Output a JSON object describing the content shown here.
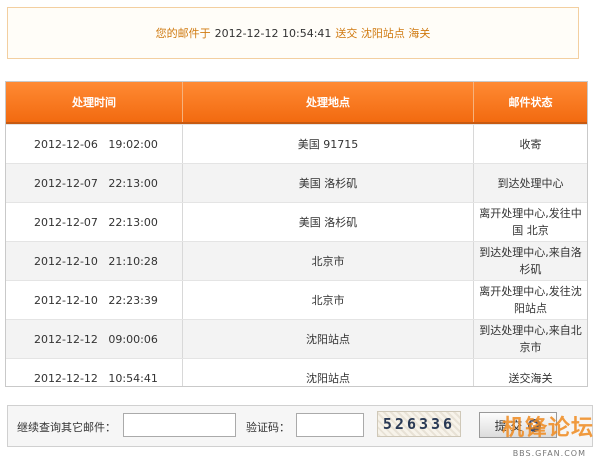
{
  "notice": {
    "prefix": "您的邮件于",
    "datetime": "2012-12-12 10:54:41",
    "status": "送交 沈阳站点 海关"
  },
  "table": {
    "headers": [
      "处理时间",
      "处理地点",
      "邮件状态"
    ],
    "rows": [
      {
        "time": "2012-12-06   19:02:00",
        "location": "美国 91715",
        "status": "收寄"
      },
      {
        "time": "2012-12-07   22:13:00",
        "location": "美国 洛杉矶",
        "status": "到达处理中心"
      },
      {
        "time": "2012-12-07   22:13:00",
        "location": "美国 洛杉矶",
        "status": "离开处理中心,发往中国 北京"
      },
      {
        "time": "2012-12-10   21:10:28",
        "location": "北京市",
        "status": "到达处理中心,来自洛杉矶"
      },
      {
        "time": "2012-12-10   22:23:39",
        "location": "北京市",
        "status": "离开处理中心,发往沈阳站点"
      },
      {
        "time": "2012-12-12   09:00:06",
        "location": "沈阳站点",
        "status": "到达处理中心,来自北京市"
      },
      {
        "time": "2012-12-12   10:54:41",
        "location": "沈阳站点",
        "status": "送交海关"
      }
    ]
  },
  "query": {
    "continue_label": "继续查询其它邮件：",
    "mail_value": "",
    "captcha_label": "验证码：",
    "captcha_value": "",
    "captcha_text": "526336",
    "submit_label": "提 交"
  },
  "watermark": {
    "main": "机锋论坛",
    "sub": "BBS.GFAN.COM"
  },
  "colors": {
    "header_orange": "#f26a10",
    "notice_orange": "#d07a10",
    "watermark_orange": "#f08a1e"
  }
}
